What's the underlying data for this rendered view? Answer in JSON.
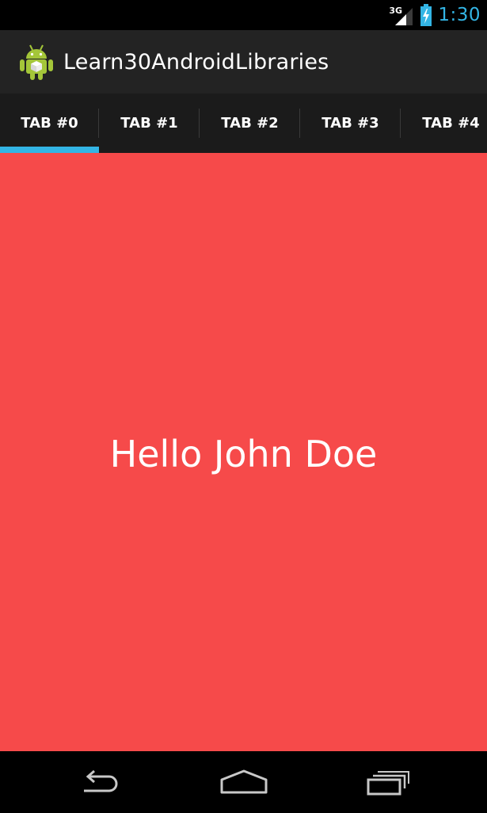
{
  "status_bar": {
    "network_type": "3G",
    "time": "1:30",
    "icons": [
      "signal-icon",
      "battery-charging-icon"
    ]
  },
  "action_bar": {
    "app_icon": "android-robot-icon",
    "title": "Learn30AndroidLibraries"
  },
  "tabs": [
    {
      "label": "TAB #0",
      "selected": true
    },
    {
      "label": "TAB #1",
      "selected": false
    },
    {
      "label": "TAB #2",
      "selected": false
    },
    {
      "label": "TAB #3",
      "selected": false
    },
    {
      "label": "TAB #4",
      "selected": false
    }
  ],
  "content": {
    "greeting": "Hello John Doe",
    "background_color": "#f64a4a"
  },
  "nav_bar": {
    "icons": [
      "back-icon",
      "home-icon",
      "recent-apps-icon"
    ]
  },
  "colors": {
    "accent": "#33b5e5",
    "action_bar": "#232323",
    "tab_bar": "#1b1b1b"
  }
}
